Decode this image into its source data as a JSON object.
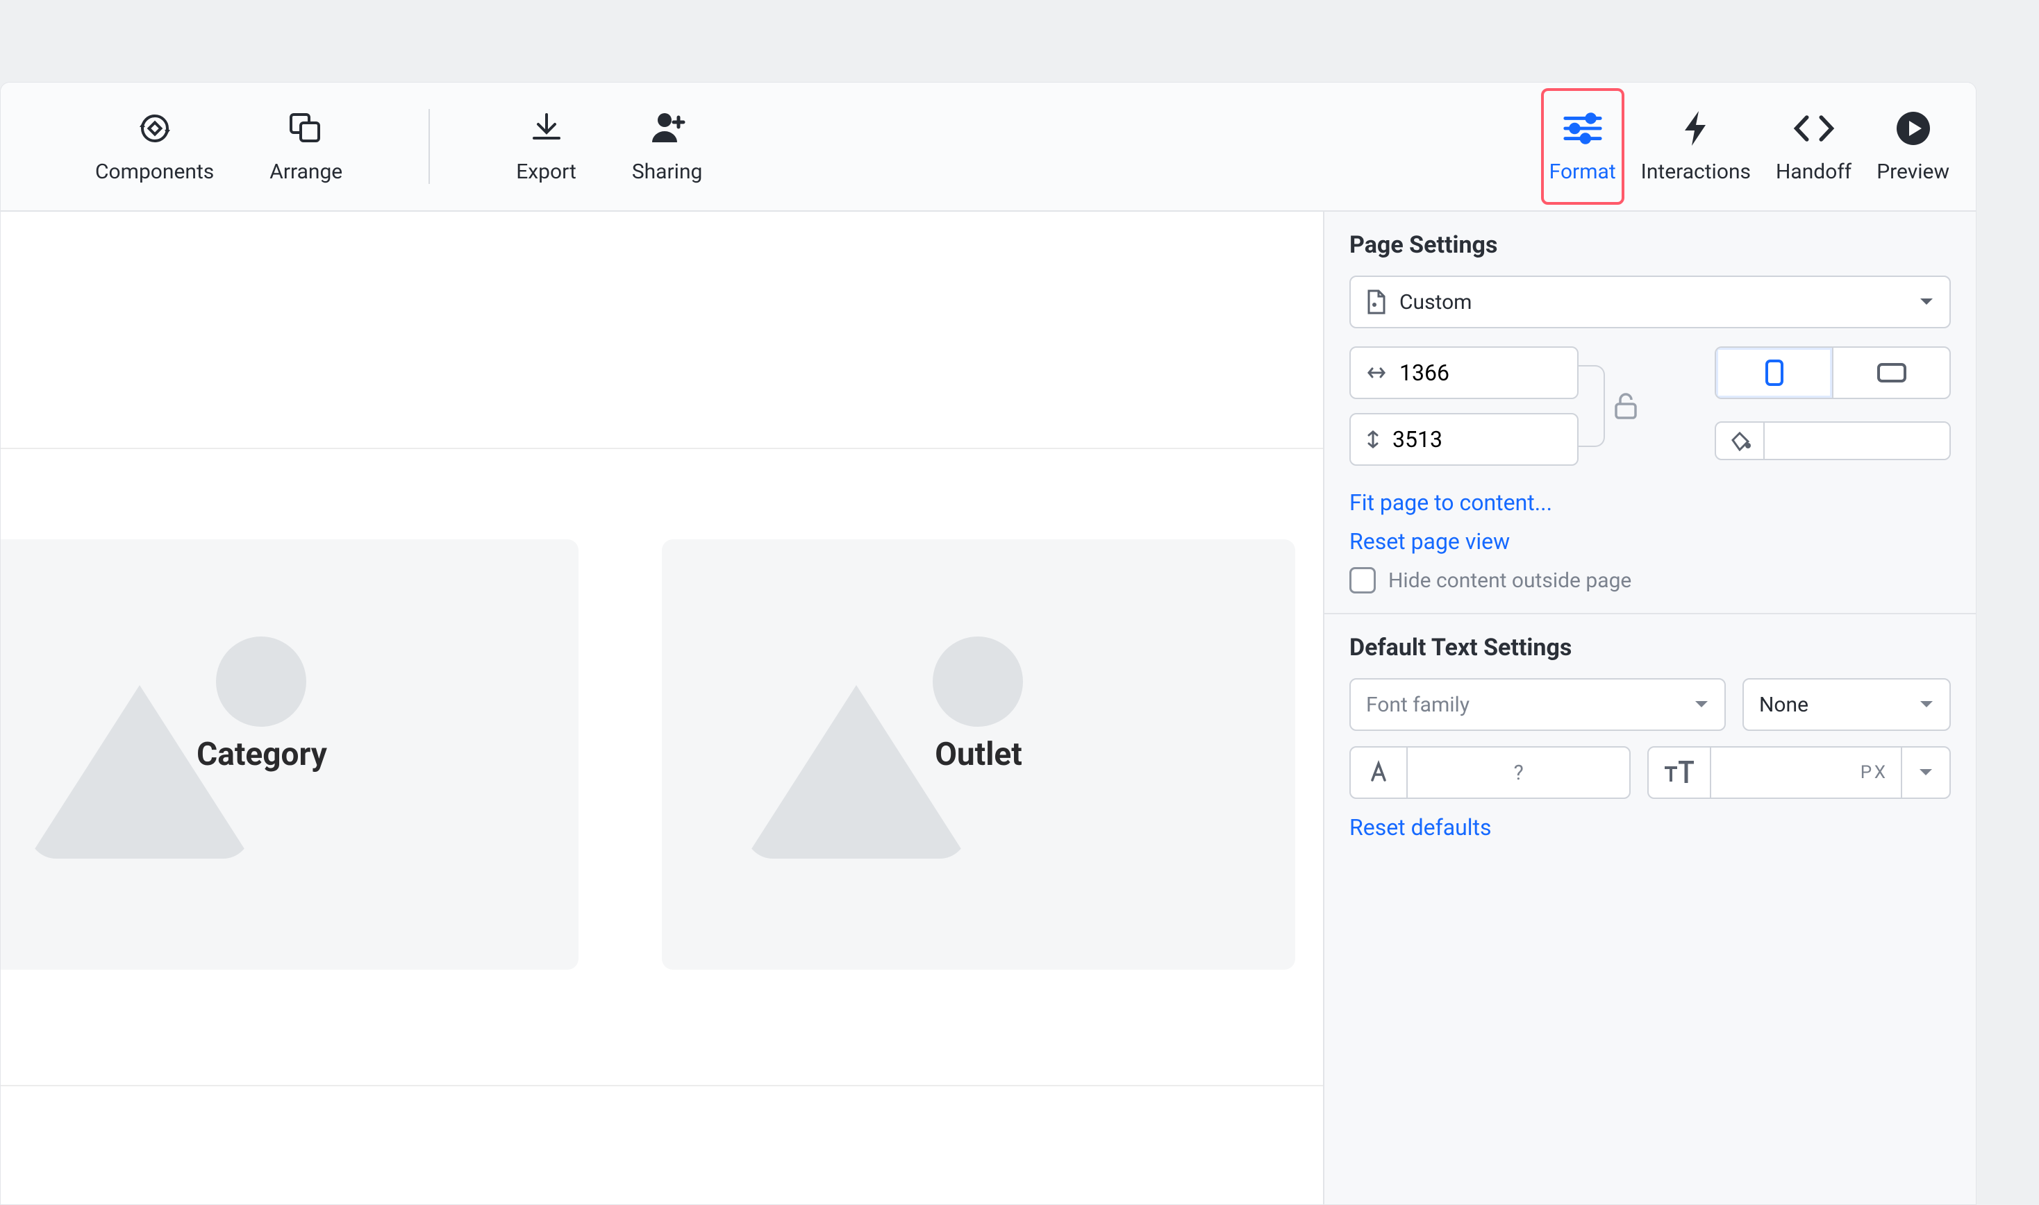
{
  "toolbar": {
    "components": "Components",
    "arrange": "Arrange",
    "export": "Export",
    "sharing": "Sharing"
  },
  "tabs": {
    "format": "Format",
    "interactions": "Interactions",
    "handoff": "Handoff",
    "preview": "Preview",
    "active": "format"
  },
  "canvas": {
    "cards": [
      {
        "title": "Category"
      },
      {
        "title": "Outlet"
      }
    ]
  },
  "pageSettings": {
    "title": "Page Settings",
    "preset": "Custom",
    "width": "1366",
    "height": "3513",
    "orientation": "portrait",
    "fitLink": "Fit page to content...",
    "resetViewLink": "Reset page view",
    "hideCheckbox": {
      "checked": false,
      "label": "Hide content outside page"
    }
  },
  "textSettings": {
    "title": "Default Text Settings",
    "fontFamilyPlaceholder": "Font family",
    "fontWeight": "None",
    "colorValue": "?",
    "sizeUnit": "PX",
    "resetLink": "Reset defaults"
  }
}
